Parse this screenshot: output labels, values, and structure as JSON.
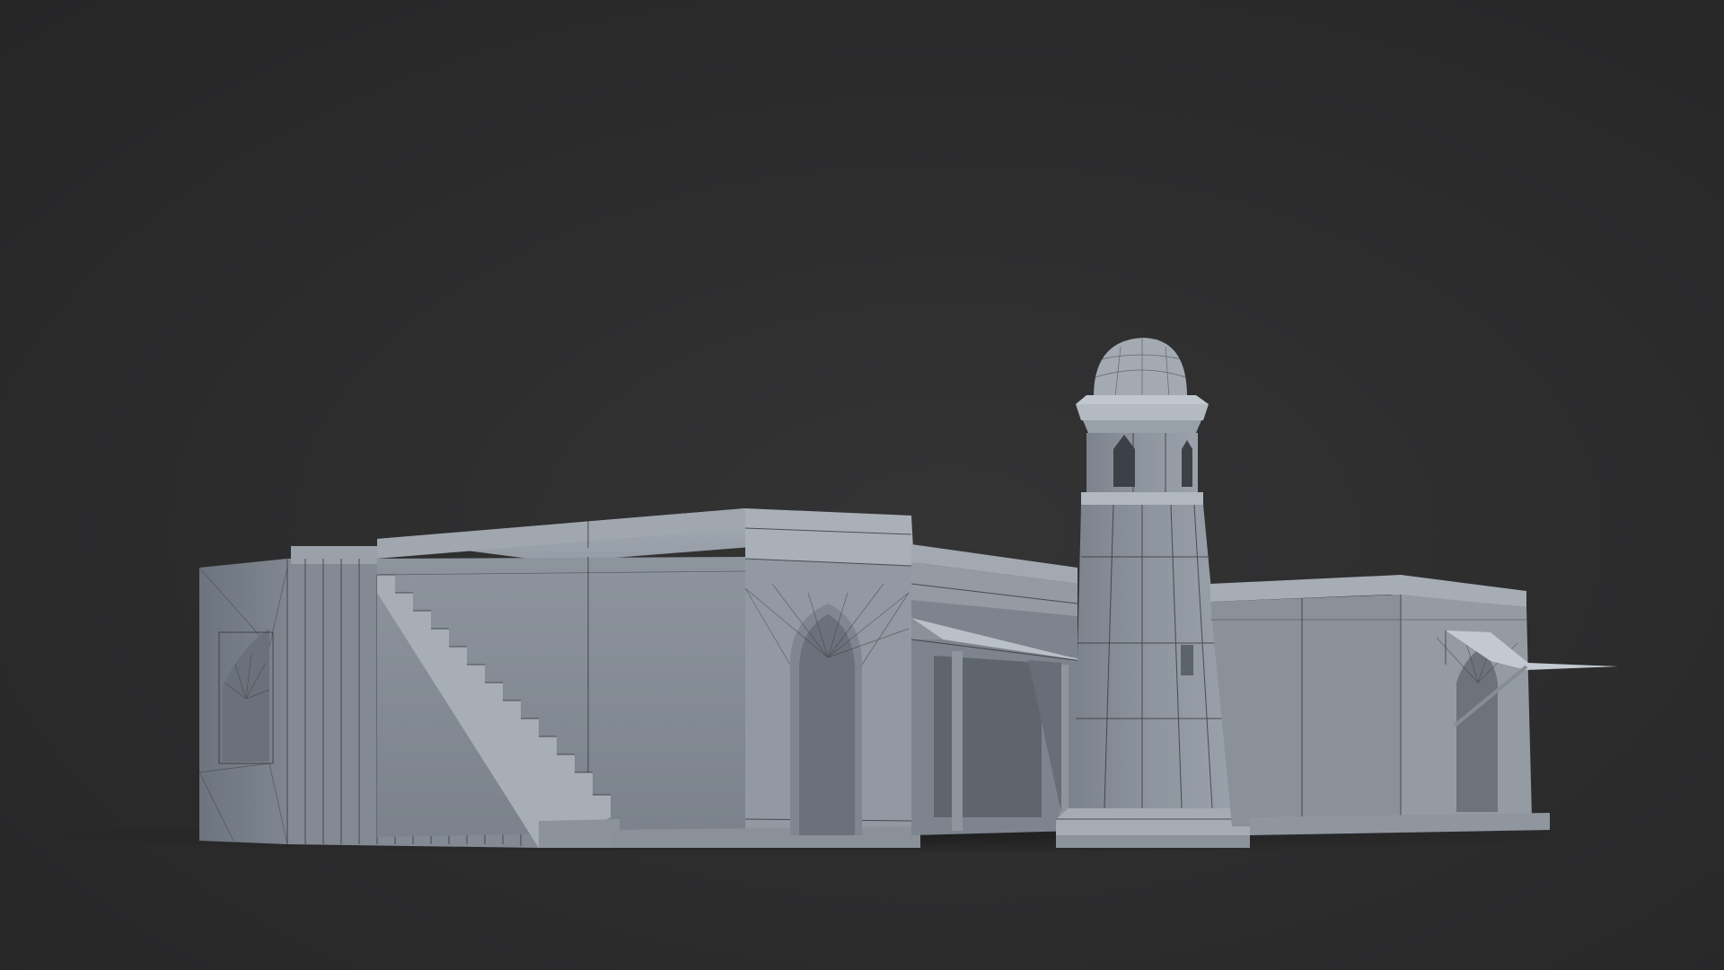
{
  "scene": {
    "background_color": "#2c2c2d",
    "model_color": "#8a9099",
    "wireframe_color": "#2f3236",
    "description_free": true
  }
}
